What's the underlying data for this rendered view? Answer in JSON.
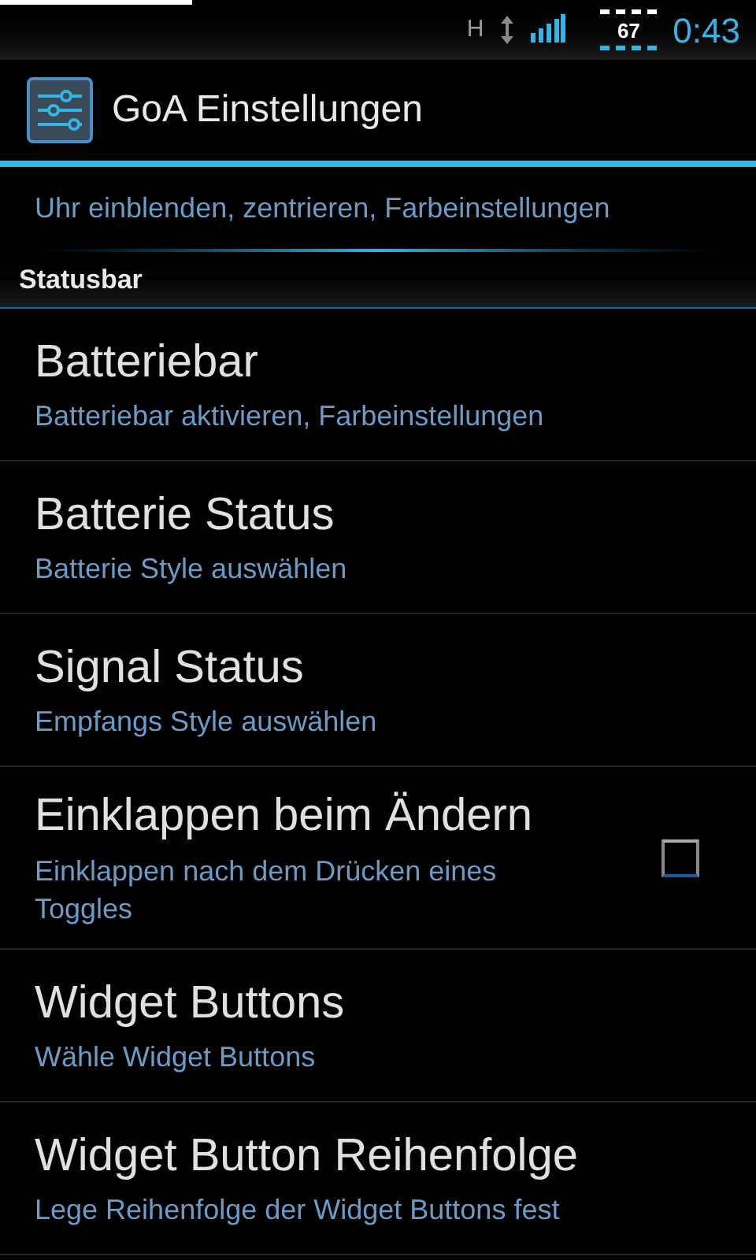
{
  "status_bar": {
    "network": "H",
    "battery": "67",
    "time": "0:43"
  },
  "action_bar": {
    "title": "GoA Einstellungen"
  },
  "partial_item": {
    "summary": "Uhr einblenden, zentrieren, Farbeinstellungen"
  },
  "category": {
    "title": "Statusbar"
  },
  "items": [
    {
      "kind": "plain",
      "title": "Batteriebar",
      "summary": "Batteriebar aktivieren, Farbeinstellungen"
    },
    {
      "kind": "plain",
      "title": "Batterie Status",
      "summary": "Batterie Style auswählen"
    },
    {
      "kind": "plain",
      "title": "Signal Status",
      "summary": "Empfangs Style auswählen"
    },
    {
      "kind": "checkbox",
      "title": "Einklappen beim Ändern",
      "summary": "Einklappen nach dem Drücken eines Toggles",
      "checked": false
    },
    {
      "kind": "plain",
      "title": "Widget Buttons",
      "summary": "Wähle Widget Buttons"
    },
    {
      "kind": "plain",
      "title": "Widget Button Reihenfolge",
      "summary": "Lege Reihenfolge der Widget Buttons fest"
    }
  ]
}
